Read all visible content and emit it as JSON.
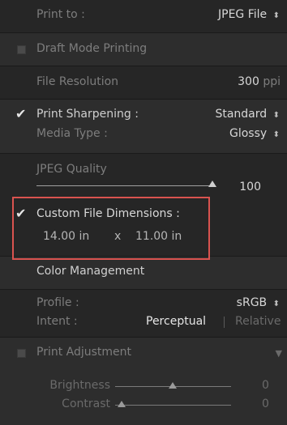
{
  "print_to": {
    "label": "Print to :",
    "value": "JPEG File",
    "updown": "⬍"
  },
  "draft_mode": {
    "label": "Draft Mode Printing"
  },
  "file_resolution": {
    "label": "File Resolution",
    "value": "300",
    "unit": "ppi"
  },
  "sharpening": {
    "label": "Print Sharpening :",
    "value": "Standard",
    "checked": true
  },
  "media_type": {
    "label": "Media Type :",
    "value": "Glossy"
  },
  "jpeg_quality": {
    "label": "JPEG Quality",
    "value": "100",
    "level_fraction": 1.0
  },
  "custom_dims": {
    "label": "Custom File Dimensions :",
    "checked": true,
    "width": "14.00",
    "height": "11.00",
    "unit": "in",
    "sep": "x"
  },
  "color_mgmt": {
    "title": "Color Management",
    "profile_label": "Profile :",
    "profile_value": "sRGB",
    "intent_label": "Intent :",
    "intent_option1": "Perceptual",
    "intent_option2": "Relative"
  },
  "print_adjust": {
    "label": "Print Adjustment",
    "brightness_label": "Brightness",
    "brightness_value": "0",
    "contrast_label": "Contrast",
    "contrast_value": "0"
  },
  "icons": {
    "check_mark": "✔",
    "up_down": "⬍",
    "triangle_down": "▼"
  },
  "colors": {
    "highlight": "#d9534f"
  }
}
